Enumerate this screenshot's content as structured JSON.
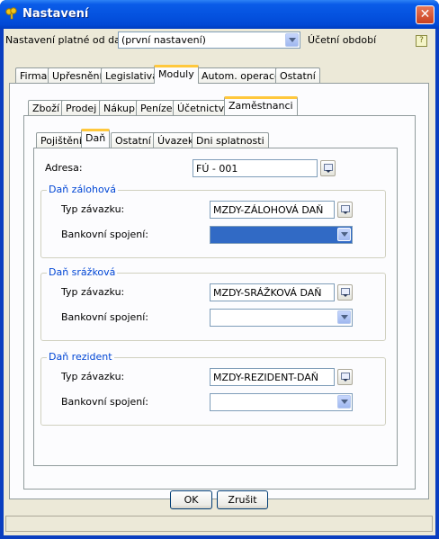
{
  "window": {
    "title": "Nastavení"
  },
  "settings_row": {
    "label": "Nastavení platné od data:",
    "value": "(první nastavení)",
    "period_label": "Účetní období"
  },
  "tabs_main": [
    "Firma",
    "Upřesnění",
    "Legislativa",
    "Moduly",
    "Autom. operace",
    "Ostatní"
  ],
  "tabs_module": [
    "Zboží",
    "Prodej",
    "Nákup",
    "Peníze",
    "Účetnictví",
    "Zaměstnanci"
  ],
  "tabs_employee": [
    "Pojištění",
    "Daň",
    "Ostatní",
    "Úvazek",
    "Dni splatnosti"
  ],
  "address": {
    "label": "Adresa:",
    "value": "FÚ - 001"
  },
  "groups": [
    {
      "title": "Daň zálohová",
      "type_label": "Typ závazku:",
      "type_value": "MZDY-ZÁLOHOVÁ DAŇ",
      "bank_label": "Bankovní spojení:",
      "bank_value": ""
    },
    {
      "title": "Daň srážková",
      "type_label": "Typ závazku:",
      "type_value": "MZDY-SRÁŽKOVÁ DAŇ",
      "bank_label": "Bankovní spojení:",
      "bank_value": ""
    },
    {
      "title": "Daň rezident",
      "type_label": "Typ závazku:",
      "type_value": "MZDY-REZIDENT-DAŇ",
      "bank_label": "Bankovní spojení:",
      "bank_value": ""
    }
  ],
  "buttons": {
    "ok": "OK",
    "cancel": "Zrušit"
  },
  "icons": {
    "app": "keys-icon",
    "close": "close-icon",
    "help": "help-icon",
    "picker": "picker-icon",
    "dropdown": "chevron-down-icon"
  },
  "colors": {
    "titlebar": "#0553e0",
    "tab_active_accent": "#ffc83c",
    "group_title": "#0046d5",
    "selection": "#316ac5"
  }
}
